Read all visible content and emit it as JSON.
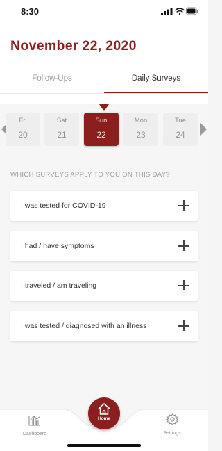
{
  "status_bar": {
    "time": "8:30"
  },
  "header": {
    "date_title": "November 22, 2020"
  },
  "tabs": [
    {
      "label": "Follow-Ups",
      "active": false
    },
    {
      "label": "Daily Surveys",
      "active": true
    }
  ],
  "days": [
    {
      "name": "Fri",
      "num": "20",
      "selected": false
    },
    {
      "name": "Sat",
      "num": "21",
      "selected": false
    },
    {
      "name": "Sun",
      "num": "22",
      "selected": true
    },
    {
      "name": "Mon",
      "num": "23",
      "selected": false
    },
    {
      "name": "Tue",
      "num": "24",
      "selected": false
    }
  ],
  "surveys": {
    "question": "WHICH SURVEYS APPLY TO YOU ON THIS DAY?",
    "items": [
      {
        "label": "I was tested for COVID-19"
      },
      {
        "label": "I had / have symptoms"
      },
      {
        "label": "I traveled / am traveling"
      },
      {
        "label": "I was tested / diagnosed with an illness"
      }
    ]
  },
  "nav": {
    "dashboard": "Dashboard",
    "home": "Home",
    "settings": "Settings"
  },
  "colors": {
    "accent": "#8a1f1d",
    "muted": "#9a9a9a",
    "card": "#ffffff"
  }
}
